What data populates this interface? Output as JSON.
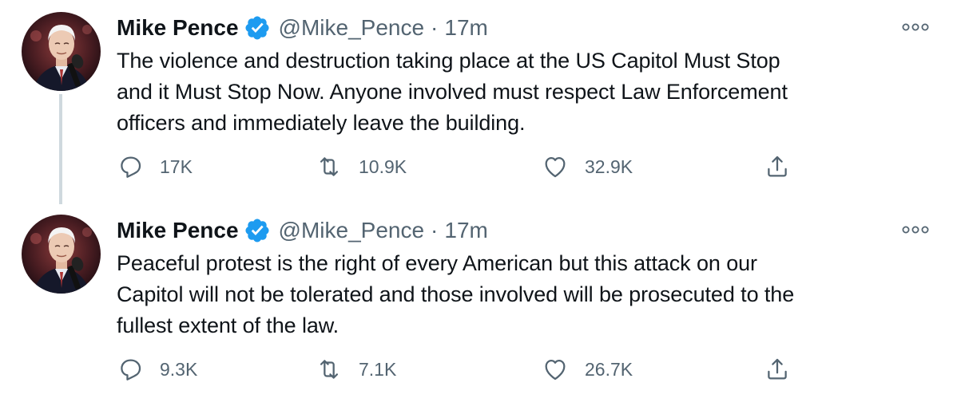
{
  "tweets": [
    {
      "author_name": "Mike Pence",
      "handle": "@Mike_Pence",
      "separator": "·",
      "time": "17m",
      "text": "The violence and destruction taking place at the US Capitol Must Stop\nand it Must Stop Now. Anyone involved must respect Law Enforcement\nofficers and immediately leave the building.",
      "replies": "17K",
      "retweets": "10.9K",
      "likes": "32.9K",
      "has_thread_line": true
    },
    {
      "author_name": "Mike Pence",
      "handle": "@Mike_Pence",
      "separator": "·",
      "time": "17m",
      "text": "Peaceful protest is the right of every American but this attack on our\nCapitol will not be tolerated and those involved will be prosecuted to the\nfullest extent of the law.",
      "replies": "9.3K",
      "retweets": "7.1K",
      "likes": "26.7K",
      "has_thread_line": false
    }
  ],
  "icons": {
    "verified": "verified-badge-icon",
    "more": "more-options-icon",
    "reply": "reply-icon",
    "retweet": "retweet-icon",
    "like": "like-icon",
    "share": "share-icon"
  },
  "colors": {
    "text_primary": "#0f1419",
    "text_secondary": "#536471",
    "verified_blue": "#1d9bf0",
    "thread_line": "#cfd9de"
  }
}
